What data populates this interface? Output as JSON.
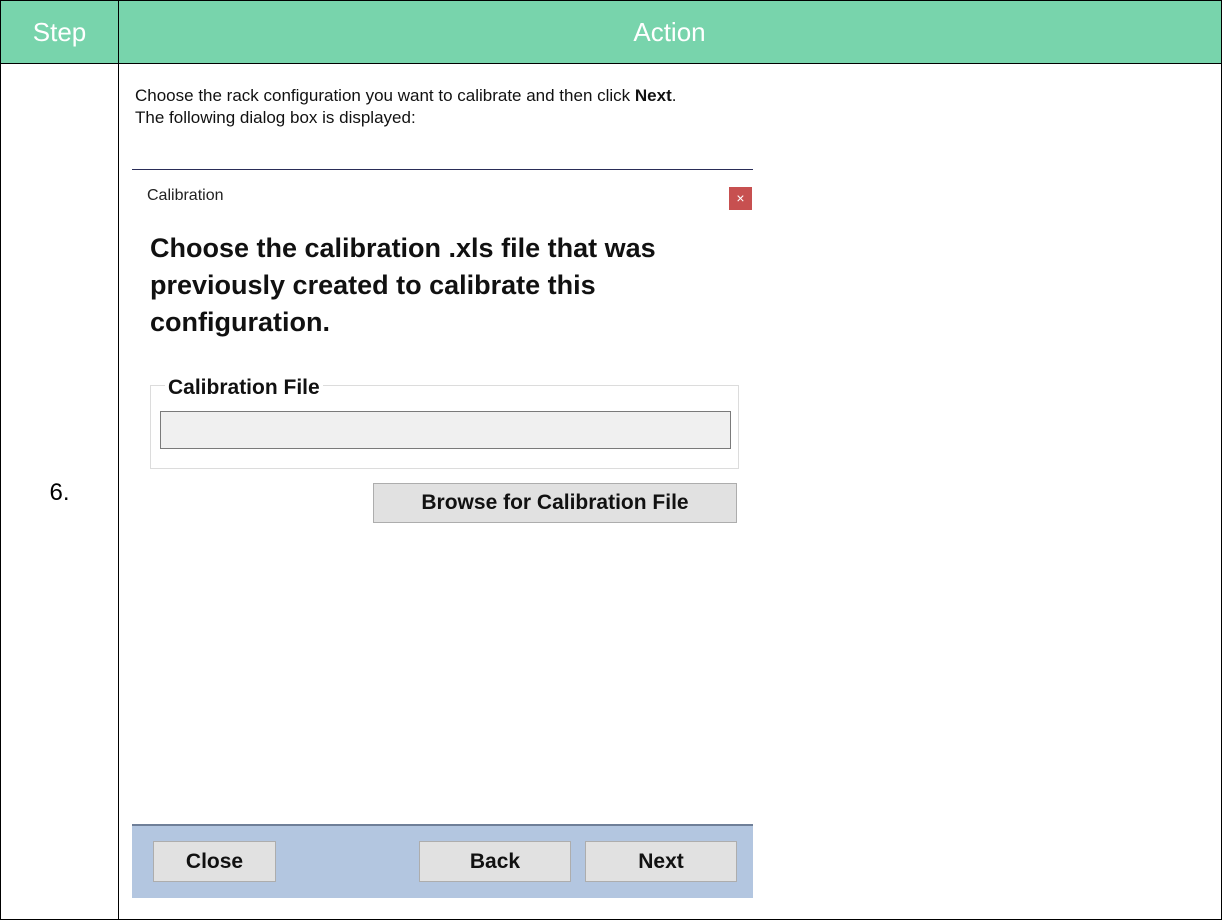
{
  "table": {
    "header_step": "Step",
    "header_action": "Action",
    "step_number": "6."
  },
  "instruction": {
    "line1_prefix": "Choose the rack configuration you want to calibrate and then click ",
    "line1_bold": "Next",
    "line1_suffix": ".",
    "line2": "The following dialog box is displayed:"
  },
  "dialog": {
    "title": "Calibration",
    "close_glyph": "×",
    "heading": "Choose the calibration .xls file that was previously created to calibrate this configuration.",
    "group_label": "Calibration File",
    "file_value": "",
    "browse_label": "Browse for Calibration File",
    "footer": {
      "close_label": "Close",
      "back_label": "Back",
      "next_label": "Next"
    }
  },
  "colors": {
    "header_bg": "#78d4ac",
    "footer_bg": "#b3c6e0",
    "close_btn_bg": "#c75050"
  }
}
